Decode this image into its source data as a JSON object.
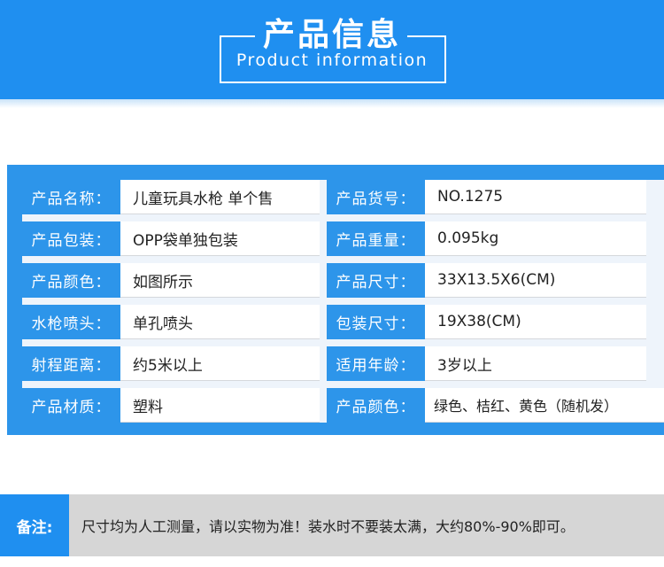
{
  "header": {
    "title_cn": "产品信息",
    "title_en": "Product information"
  },
  "spec_table": {
    "left": [
      {
        "label": "产品名称：",
        "value": "儿童玩具水枪  单个售"
      },
      {
        "label": "产品包装：",
        "value": "OPP袋单独包装"
      },
      {
        "label": "产品颜色：",
        "value": "如图所示"
      },
      {
        "label": "水枪喷头：",
        "value": "单孔喷头"
      },
      {
        "label": "射程距离：",
        "value": "约5米以上"
      },
      {
        "label": "产品材质：",
        "value": "塑料"
      }
    ],
    "right": [
      {
        "label": "产品货号：",
        "value": "NO.1275"
      },
      {
        "label": "产品重量：",
        "value": "0.095kg"
      },
      {
        "label": "产品尺寸：",
        "value": "33X13.5X6(CM)"
      },
      {
        "label": "包装尺寸：",
        "value": "19X38(CM)"
      },
      {
        "label": "适用年龄：",
        "value": "3岁以上"
      },
      {
        "label": "产品颜色：",
        "value": "绿色、桔红、黄色（随机发）"
      }
    ]
  },
  "note": {
    "label": "备注:",
    "text": "尺寸均为人工测量，请以实物为准！装水时不要装太满，大约80%-90%即可。"
  },
  "colors": {
    "brand_blue": "#1f8ff0",
    "table_blue": "#2d95ea",
    "note_gray": "#d6d6d6"
  }
}
